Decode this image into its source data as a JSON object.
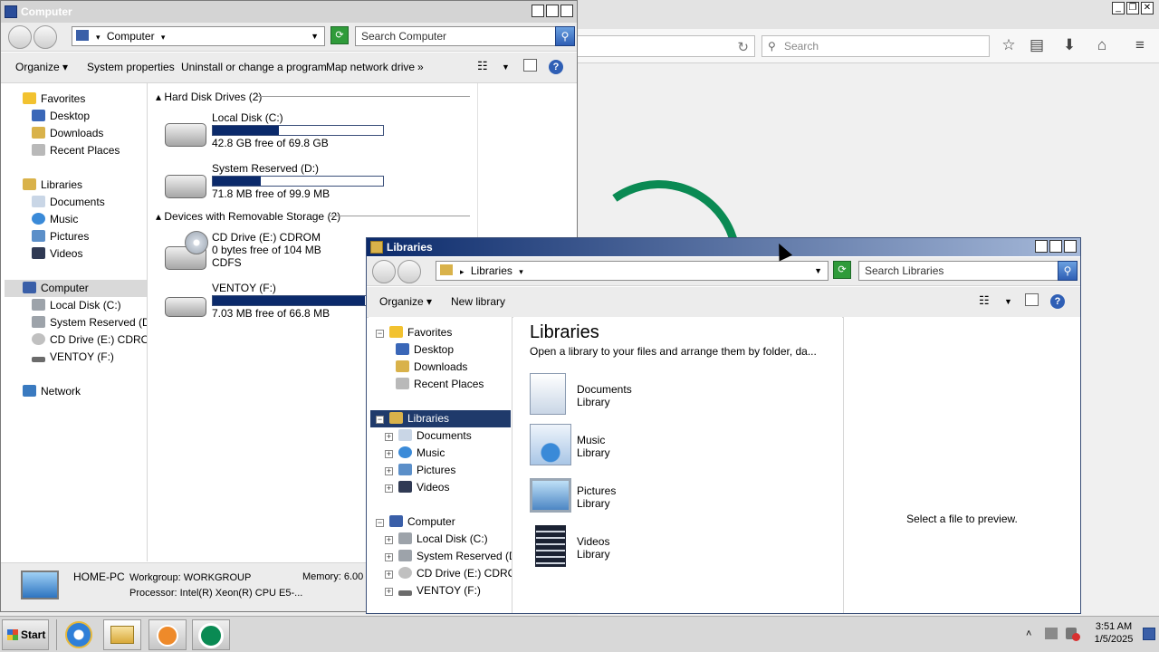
{
  "browser": {
    "search_placeholder": "Search",
    "reload_symbol": "↻"
  },
  "computer_window": {
    "title": "Computer",
    "address": "Computer",
    "search_placeholder": "Search Computer",
    "commands": [
      "Organize",
      "System properties",
      "Uninstall or change a program",
      "Map network drive",
      "»"
    ],
    "nav": {
      "favorites_label": "Favorites",
      "favorites": [
        "Desktop",
        "Downloads",
        "Recent Places"
      ],
      "libraries_label": "Libraries",
      "libraries": [
        "Documents",
        "Music",
        "Pictures",
        "Videos"
      ],
      "computer_label": "Computer",
      "drives": [
        "Local Disk (C:)",
        "System Reserved (D:)",
        "CD Drive (E:) CDROM",
        "VENTOY (F:)"
      ],
      "network_label": "Network"
    },
    "sections": {
      "hdd_header": "Hard Disk Drives (2)",
      "removable_header": "Devices with Removable Storage (2)"
    },
    "drives": [
      {
        "name": "Local Disk (C:)",
        "space": "42.8 GB free of 69.8 GB",
        "used_fraction": 0.387
      },
      {
        "name": "System Reserved (D:)",
        "space": "71.8 MB free of 99.9 MB",
        "used_fraction": 0.281
      }
    ],
    "removable": [
      {
        "name": "CD Drive (E:) CDROM",
        "space": "0 bytes free of 104 MB",
        "fs": "CDFS"
      },
      {
        "name": "VENTOY (F:)",
        "space": "7.03 MB free of 66.8 MB",
        "used_fraction": 0.895
      }
    ],
    "status": {
      "pc_name": "HOME-PC",
      "workgroup": "Workgroup: WORKGROUP",
      "memory": "Memory: 6.00",
      "processor": "Processor: Intel(R) Xeon(R) CPU E5-..."
    }
  },
  "libraries_window": {
    "title": "Libraries",
    "address": "Libraries",
    "search_placeholder": "Search Libraries",
    "commands": [
      "Organize",
      "New library"
    ],
    "nav": {
      "favorites_label": "Favorites",
      "favorites": [
        "Desktop",
        "Downloads",
        "Recent Places"
      ],
      "libraries_label": "Libraries",
      "libraries": [
        "Documents",
        "Music",
        "Pictures",
        "Videos"
      ],
      "computer_label": "Computer",
      "drives": [
        "Local Disk (C:)",
        "System Reserved (D:)",
        "CD Drive (E:) CDROM",
        "VENTOY (F:)"
      ]
    },
    "heading": "Libraries",
    "subheading": "Open a library to your files and arrange them by folder, da...",
    "items": [
      {
        "name": "Documents",
        "type": "Library"
      },
      {
        "name": "Music",
        "type": "Library"
      },
      {
        "name": "Pictures",
        "type": "Library"
      },
      {
        "name": "Videos",
        "type": "Library"
      }
    ],
    "preview_text": "Select a file to preview."
  },
  "taskbar": {
    "start_label": "Start",
    "time": "3:51 AM",
    "date": "1/5/2025",
    "tray_expand": "˄"
  },
  "colors": {
    "accent_dark": "#1f3a6b",
    "drive_bar": "#0b2a6b",
    "refresh_green": "#2f9b3a",
    "browser_logo_green": "#0a8a53"
  }
}
